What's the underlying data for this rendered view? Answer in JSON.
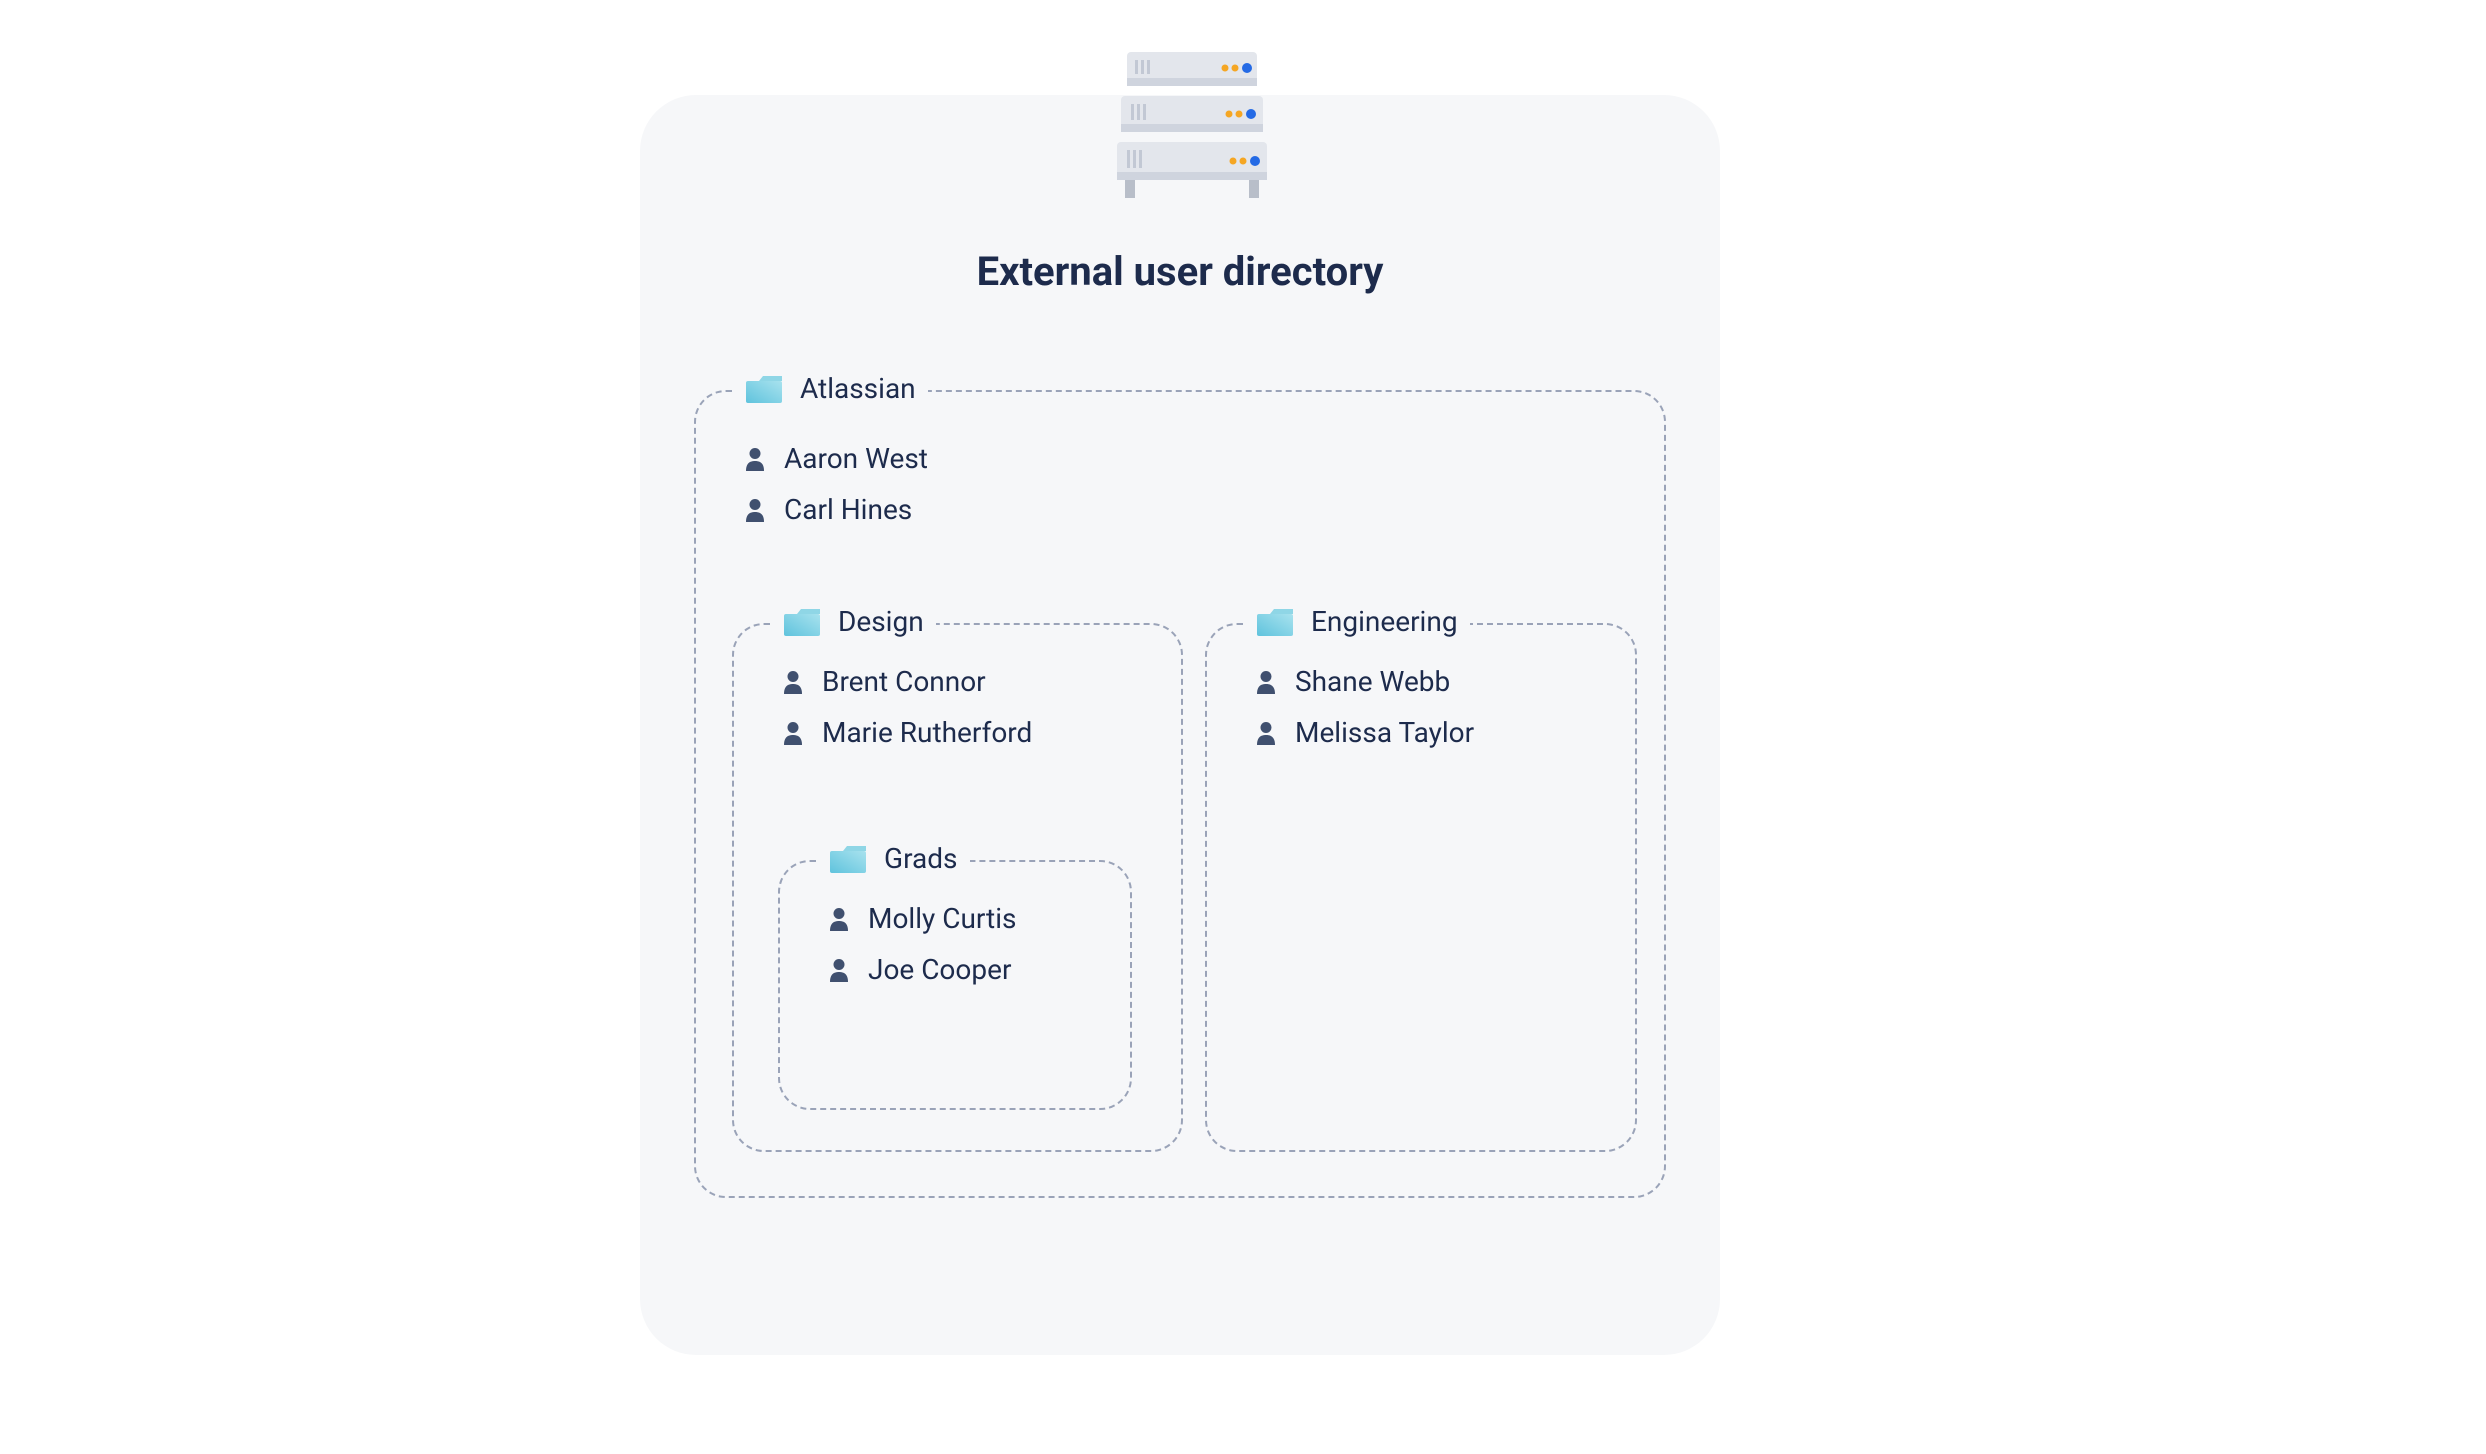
{
  "title": "External user directory",
  "directory": {
    "name": "Atlassian",
    "users": [
      "Aaron West",
      "Carl Hines"
    ],
    "children": {
      "design": {
        "name": "Design",
        "users": [
          "Brent Connor",
          "Marie Rutherford"
        ],
        "children": {
          "grads": {
            "name": "Grads",
            "users": [
              "Molly Curtis",
              "Joe Cooper"
            ]
          }
        }
      },
      "engineering": {
        "name": "Engineering",
        "users": [
          "Shane Webb",
          "Melissa Taylor"
        ]
      }
    }
  },
  "icons": {
    "folder": "folder-icon",
    "person": "person-icon",
    "server": "server-icon"
  }
}
